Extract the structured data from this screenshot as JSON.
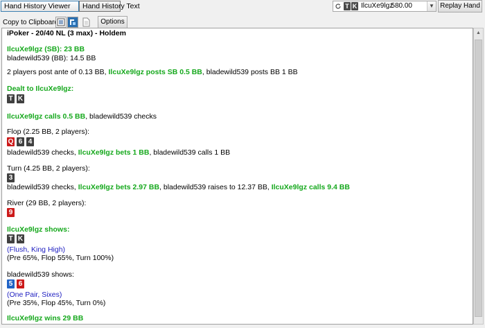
{
  "topbar": {
    "tab_viewer": "Hand History Viewer",
    "tab_text": "Hand History Text",
    "player_select": {
      "name": "IlcuXe9lgz",
      "stack": "580.00",
      "cards": [
        "T",
        "K"
      ]
    },
    "replay_label": "Replay Hand"
  },
  "toolbar": {
    "copy_label": "Copy to Clipboard:",
    "options_label": "Options"
  },
  "hand": {
    "header": "iPoker - 20/40 NL (3 max) - Holdem",
    "players": {
      "p1": "IlcuXe9lgz (SB): 23 BB",
      "p2": "bladewild539 (BB): 14.5 BB"
    },
    "antes": {
      "pre": "2 players post ante of 0.13 BB, ",
      "hi": "IlcuXe9lgz posts SB 0.5 BB",
      "post": ", bladewild539 posts BB 1 BB"
    },
    "dealt": {
      "label": "Dealt to IlcuXe9lgz:",
      "cards": [
        {
          "rank": "T",
          "suit": "black"
        },
        {
          "rank": "K",
          "suit": "black"
        }
      ]
    },
    "preflop": {
      "hi": "IlcuXe9lgz calls 0.5 BB",
      "post": ", bladewild539 checks"
    },
    "flop": {
      "label": "Flop (2.25 BB, 2 players):",
      "cards": [
        {
          "rank": "Q",
          "suit": "red"
        },
        {
          "rank": "6",
          "suit": "black"
        },
        {
          "rank": "4",
          "suit": "black"
        }
      ],
      "pre": "bladewild539 checks, ",
      "hi": "IlcuXe9lgz bets 1 BB",
      "post": ", bladewild539 calls 1 BB"
    },
    "turn": {
      "label": "Turn (4.25 BB, 2 players):",
      "cards": [
        {
          "rank": "3",
          "suit": "black"
        }
      ],
      "pre": "bladewild539 checks, ",
      "hi1": "IlcuXe9lgz bets 2.97 BB",
      "mid": ", bladewild539 raises to 12.37 BB, ",
      "hi2": "IlcuXe9lgz calls 9.4 BB"
    },
    "river": {
      "label": "River (29 BB, 2 players):",
      "cards": [
        {
          "rank": "9",
          "suit": "red"
        }
      ]
    },
    "showdown1": {
      "label": "IlcuXe9lgz shows:",
      "cards": [
        {
          "rank": "T",
          "suit": "black"
        },
        {
          "rank": "K",
          "suit": "black"
        }
      ],
      "hand": "(Flush, King High)",
      "equity": "(Pre 65%, Flop 55%, Turn 100%)"
    },
    "showdown2": {
      "label": "bladewild539 shows:",
      "cards": [
        {
          "rank": "5",
          "suit": "blue"
        },
        {
          "rank": "6",
          "suit": "red"
        }
      ],
      "hand": "(One Pair, Sixes)",
      "equity": "(Pre 35%, Flop 45%, Turn 0%)"
    },
    "result": "IlcuXe9lgz wins 29 BB"
  },
  "colors": {
    "hero_green": "#15a81c",
    "hand_blue": "#1c1cc0",
    "red_card": "#cc1a1a",
    "black_card": "#404040",
    "blue_card": "#1f63c6"
  }
}
